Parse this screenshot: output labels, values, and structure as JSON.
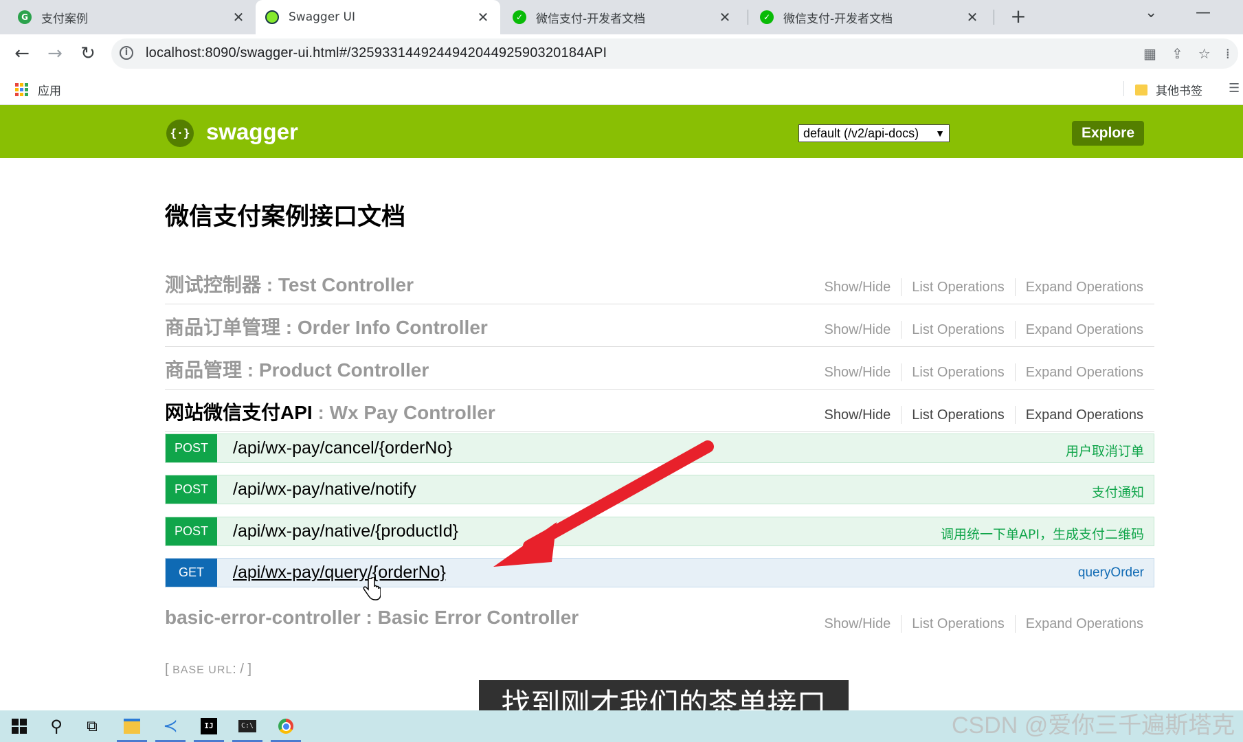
{
  "browser": {
    "tabs": [
      {
        "title": "支付案例",
        "icon": "circle-g-icon",
        "active": false
      },
      {
        "title": "Swagger UI",
        "icon": "swagger-favicon-icon",
        "active": true
      },
      {
        "title": "微信支付-开发者文档",
        "icon": "wechat-icon",
        "active": false
      },
      {
        "title": "微信支付-开发者文档",
        "icon": "wechat-icon",
        "active": false
      }
    ],
    "new_tab": "+",
    "url": "localhost:8090/swagger-ui.html#/3259331449244942044925903201​84API",
    "bookmarks": {
      "apps": "应用",
      "other": "其他书签"
    }
  },
  "swagger": {
    "brand": "swagger",
    "spec_select": "default (/v2/api-docs)",
    "explore": "Explore",
    "doc_title": "微信支付案例接口文档",
    "links": {
      "show_hide": "Show/Hide",
      "list_ops": "List Operations",
      "expand_ops": "Expand Operations"
    },
    "resources": [
      {
        "zh": "测试控制器",
        "sep": " : ",
        "en": "Test Controller"
      },
      {
        "zh": "商品订单管理",
        "sep": " : ",
        "en": "Order Info Controller"
      },
      {
        "zh": "商品管理",
        "sep": " : ",
        "en": "Product Controller"
      },
      {
        "zh": "网站微信支付API",
        "sep": " : ",
        "en": "Wx Pay Controller"
      },
      {
        "zh": "basic-error-controller",
        "sep": " : ",
        "en": "Basic Error Controller"
      }
    ],
    "operations": [
      {
        "method": "POST",
        "path": "/api/wx-pay/cancel/{orderNo}",
        "summary": "用户取消订单"
      },
      {
        "method": "POST",
        "path": "/api/wx-pay/native/notify",
        "summary": "支付通知"
      },
      {
        "method": "POST",
        "path": "/api/wx-pay/native/{productId}",
        "summary": "调用统一下单API，生成支付二维码"
      },
      {
        "method": "GET",
        "path": "/api/wx-pay/query/{orderNo}",
        "summary": "queryOrder"
      }
    ],
    "base_url": {
      "label": "BASE URL",
      "value": "/"
    }
  },
  "overlay": {
    "subtitle": "找到刚才我们的茶单接口",
    "watermark": "CSDN @爱你三千遍斯塔克"
  },
  "colors": {
    "swagger_green": "#89bf04",
    "post": "#10a54a",
    "get": "#0f6ab4",
    "arrow": "#e8212b"
  }
}
